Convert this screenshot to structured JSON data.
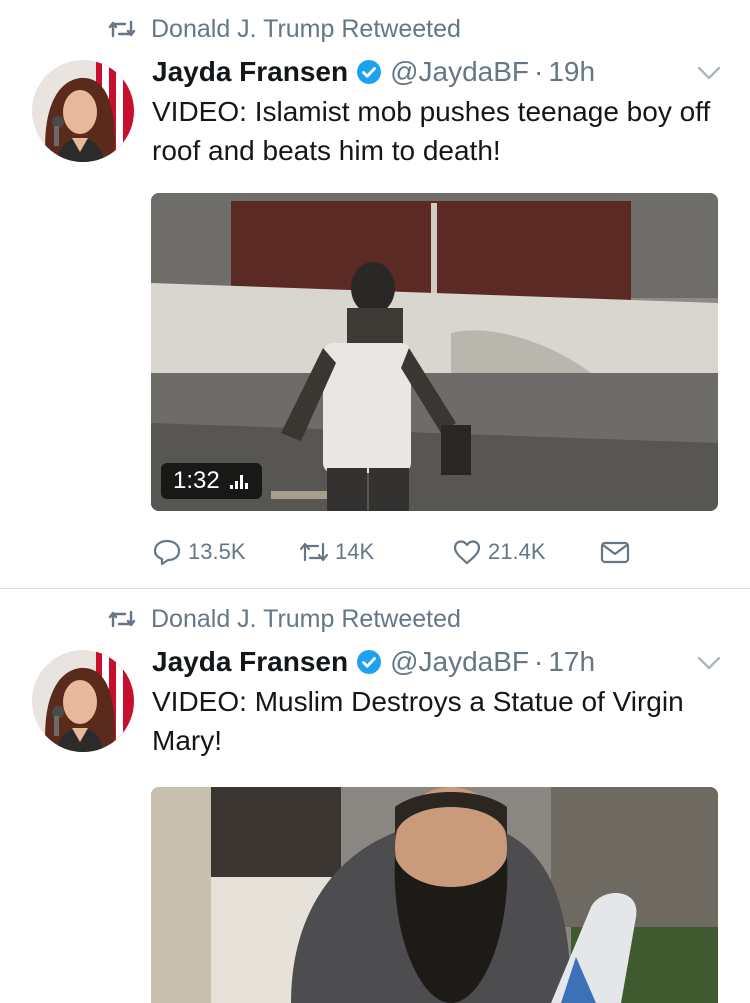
{
  "tweets": [
    {
      "retweeted_by": "Donald J. Trump Retweeted",
      "author_name": "Jayda Fransen",
      "handle": "@JaydaBF",
      "separator": "·",
      "time": "19h",
      "text": "VIDEO: Islamist mob pushes teenage boy off roof and beats him to death!",
      "video_duration": "1:32",
      "replies": "13.5K",
      "retweets": "14K",
      "likes": "21.4K"
    },
    {
      "retweeted_by": "Donald J. Trump Retweeted",
      "author_name": "Jayda Fransen",
      "handle": "@JaydaBF",
      "separator": "·",
      "time": "17h",
      "text": "VIDEO: Muslim Destroys a Statue of Virgin Mary!"
    }
  ],
  "colors": {
    "accent": "#1da1f2",
    "secondary_text": "#657786",
    "divider": "#d8dee3"
  },
  "icons": [
    "retweet-icon",
    "verified-badge-icon",
    "chevron-down-icon",
    "reply-icon",
    "like-icon",
    "direct-message-icon",
    "volume-bars-icon"
  ]
}
